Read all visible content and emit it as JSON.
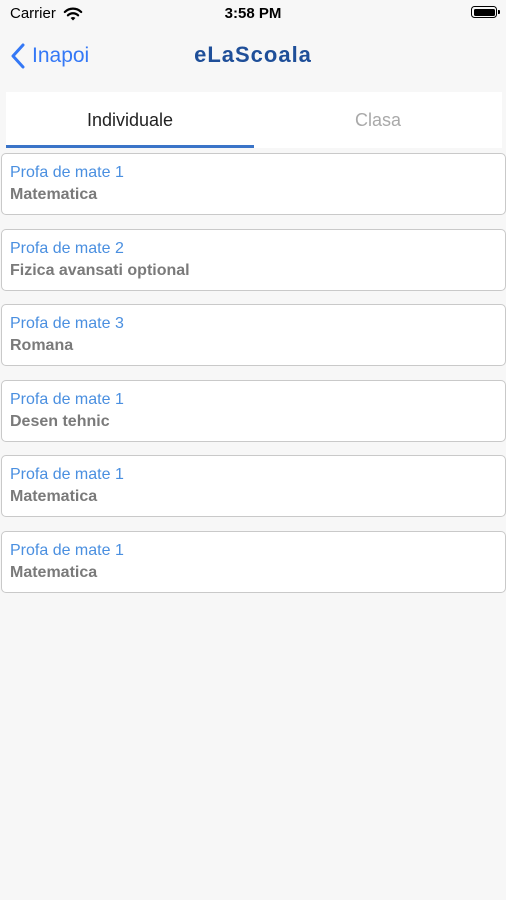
{
  "status_bar": {
    "carrier": "Carrier",
    "time": "3:58 PM",
    "wifi_icon": "wifi-icon",
    "battery_icon": "battery-icon"
  },
  "nav": {
    "back_label": "Inapoi",
    "back_icon": "chevron-left-icon",
    "title": "eLaScoala"
  },
  "tabs": [
    {
      "label": "Individuale",
      "active": true
    },
    {
      "label": "Clasa",
      "active": false
    }
  ],
  "items": [
    {
      "teacher": "Profa de mate 1",
      "subject": "Matematica"
    },
    {
      "teacher": "Profa de mate 2",
      "subject": "Fizica avansati optional"
    },
    {
      "teacher": "Profa de mate 3",
      "subject": "Romana"
    },
    {
      "teacher": "Profa de mate 1",
      "subject": "Desen tehnic"
    },
    {
      "teacher": "Profa de mate 1",
      "subject": "Matematica"
    },
    {
      "teacher": "Profa de mate 1",
      "subject": "Matematica"
    }
  ],
  "colors": {
    "accent": "#3478f6",
    "title": "#1f4f99",
    "teacher_text": "#4a8fe0",
    "subject_text": "#7a7a7a",
    "tab_indicator": "#3a74c8",
    "background": "#f7f7f7"
  }
}
